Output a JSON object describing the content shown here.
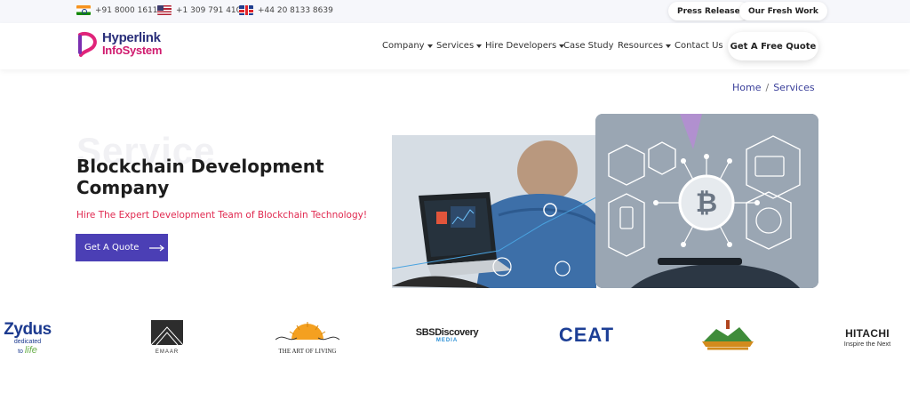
{
  "topbar": {
    "phones": [
      {
        "flag": "india-flag",
        "number": "+91 8000 161161"
      },
      {
        "flag": "us-flag",
        "number": "+1 309 791 4105"
      },
      {
        "flag": "uk-flag",
        "number": "+44 20 8133 8639"
      }
    ],
    "press_release": "Press Release",
    "fresh_work": "Our Fresh Work"
  },
  "header": {
    "logo_line1": "Hyperlink",
    "logo_line2": "InfoSystem",
    "nav": [
      {
        "label": "Company",
        "dropdown": true
      },
      {
        "label": "Services",
        "dropdown": true
      },
      {
        "label": "Hire Developers",
        "dropdown": true
      },
      {
        "label": "Case Study",
        "dropdown": false
      },
      {
        "label": "Resources",
        "dropdown": true
      },
      {
        "label": "Contact Us",
        "dropdown": false
      }
    ],
    "quote_button": "Get A Free Quote"
  },
  "breadcrumb": {
    "home": "Home",
    "separator": "/",
    "current": "Services"
  },
  "hero": {
    "ghost_text": "Service",
    "title": "Blockchain Development Company",
    "subtitle": "Hire The Expert Development Team of Blockchain Technology!",
    "cta": "Get A Quote"
  },
  "clients": {
    "zydus_name": "Zydus",
    "zydus_tag1": "dedicated",
    "zydus_tag2": "to",
    "zydus_tag3": "life",
    "emaar": "EMAAR",
    "art_of_living": "THE ART OF LIVING",
    "sbs_line1": "SBS",
    "sbs_line2": "Discovery",
    "sbs_line3": "MEDIA",
    "ceat": "CEAT",
    "hitachi": "HITACHI",
    "hitachi_tag": "Inspire the Next"
  },
  "colors": {
    "accent": "#4b3fb5",
    "subtitle": "#e0284f",
    "breadcrumb": "#3a3f9a"
  }
}
